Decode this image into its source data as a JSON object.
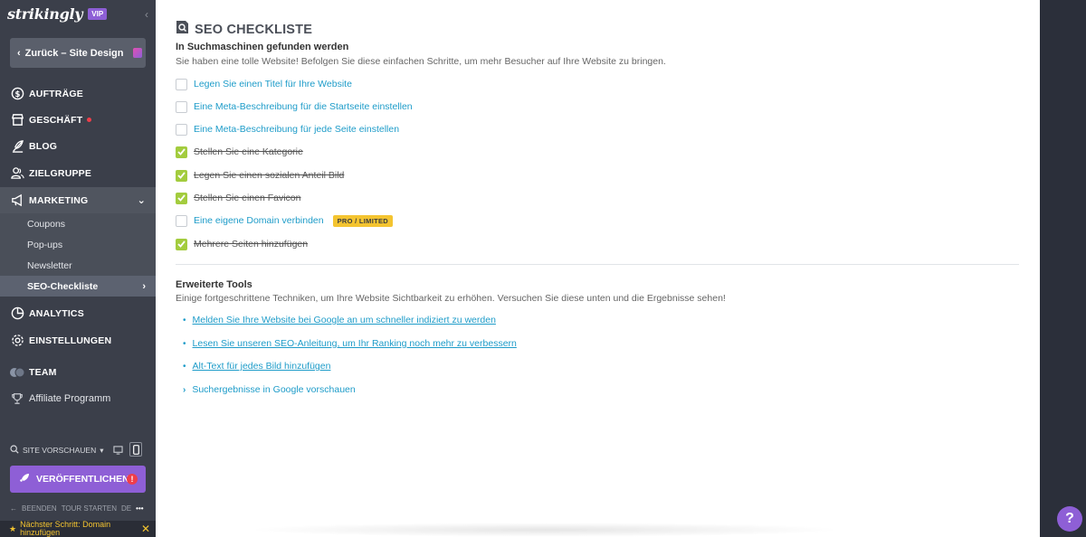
{
  "sidebar": {
    "brand": "strikingly",
    "vip": "VIP",
    "back_label": "Zurück – Site Design",
    "nav": {
      "orders": "AUFTRÄGE",
      "store": "GESCHÄFT",
      "blog": "BLOG",
      "audience": "ZIELGRUPPE",
      "marketing": "MARKETING",
      "analytics": "ANALYTICS",
      "settings": "EINSTELLUNGEN",
      "team": "TEAM",
      "affiliate": "Affiliate Programm"
    },
    "marketing_sub": [
      "Coupons",
      "Pop-ups",
      "Newsletter",
      "SEO-Checkliste"
    ],
    "preview_label": "SITE VORSCHAUEN",
    "publish_label": "VERÖFFENTLICHEN",
    "tour": {
      "exit": "BEENDEN",
      "start": "TOUR STARTEN",
      "lang": "DE"
    },
    "next_step": "Nächster Schritt: Domain hinzufügen"
  },
  "main": {
    "title": "SEO CHECKLISTE",
    "section1": {
      "title": "In Suchmaschinen gefunden werden",
      "desc": "Sie haben eine tolle Website! Befolgen Sie diese einfachen Schritte, um mehr Besucher auf Ihre Website zu bringen.",
      "items": [
        {
          "label": "Legen Sie einen Titel für Ihre Website",
          "done": false
        },
        {
          "label": "Eine Meta-Beschreibung für die Startseite einstellen",
          "done": false
        },
        {
          "label": "Eine Meta-Beschreibung für jede Seite einstellen",
          "done": false
        },
        {
          "label": "Stellen Sie eine Kategorie",
          "done": true
        },
        {
          "label": "Legen Sie einen sozialen Anteil Bild",
          "done": true
        },
        {
          "label": "Stellen Sie einen Favicon",
          "done": true
        },
        {
          "label": "Eine eigene Domain verbinden",
          "done": false
        },
        {
          "label": "Mehrere Seiten hinzufügen",
          "done": true
        }
      ],
      "pro_badge": "PRO / LIMITED"
    },
    "section2": {
      "title": "Erweiterte Tools",
      "desc": "Einige fortgeschrittene Techniken, um Ihre Website Sichtbarkeit zu erhöhen. Versuchen Sie diese unten und die Ergebnisse sehen!",
      "links": [
        "Melden Sie Ihre Website bei Google an um schneller indiziert zu werden",
        "Lesen Sie unseren SEO-Anleitung, um Ihr Ranking noch mehr zu verbessern",
        "Alt-Text für jedes Bild hinzufügen"
      ],
      "preview_link": "Suchergebnisse in Google vorschauen"
    }
  },
  "help": "?",
  "colors": {
    "accent": "#8e5fd6",
    "link": "#1e9cc9",
    "check": "#a3cc3e",
    "badge": "#f4c430",
    "sidebar": "#3b3f4a"
  }
}
